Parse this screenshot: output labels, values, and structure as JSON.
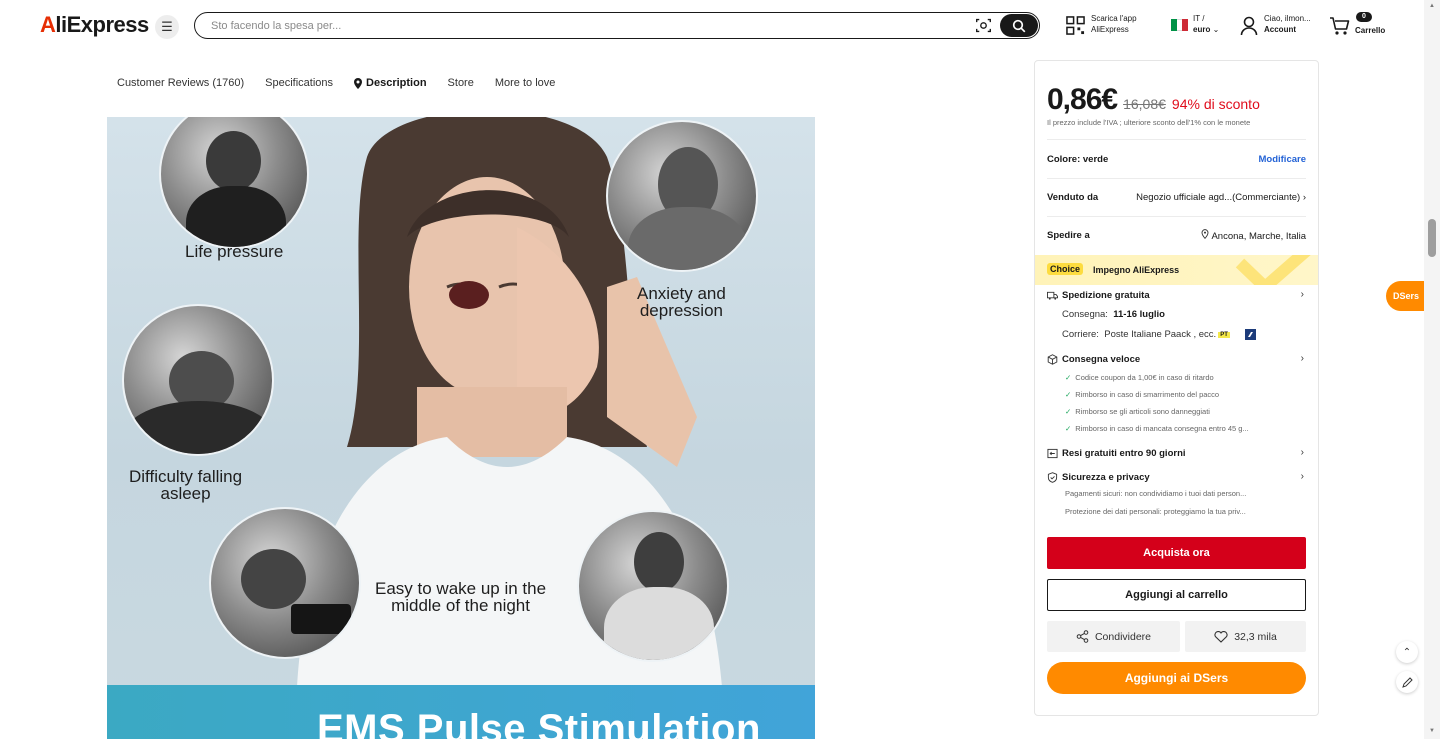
{
  "header": {
    "logo_text": "AliExpress",
    "search_placeholder": "Sto facendo la spesa per...",
    "app_line1": "Scarica l'app",
    "app_line2": "AliExpress",
    "lang_line1": "IT /",
    "lang_line2": "euro",
    "account_line1": "Ciao, ilmon...",
    "account_line2": "Account",
    "cart_count": "0",
    "cart_label": "Carrello"
  },
  "tabs": [
    {
      "label": "Customer Reviews (1760)"
    },
    {
      "label": "Specifications"
    },
    {
      "label": "Description"
    },
    {
      "label": "Store"
    },
    {
      "label": "More to love"
    }
  ],
  "product_image": {
    "captions": {
      "life_pressure": "Life pressure",
      "anxiety_1": "Anxiety and",
      "anxiety_2": "depression",
      "difficulty_1": "Difficulty falling",
      "difficulty_2": "asleep",
      "easy_1": "Easy to wake up in the",
      "easy_2": "middle of the night"
    },
    "banner_title": "EMS Pulse Stimulation"
  },
  "panel": {
    "price": "0,86€",
    "old_price": "16,08€",
    "discount": "94% di sconto",
    "vat_note": "Il prezzo include l'IVA ; ulteriore sconto dell'1% con le monete",
    "color_label": "Colore: verde",
    "color_edit": "Modificare",
    "seller_label": "Venduto da",
    "seller_value": "Negozio ufficiale agd...(Commerciante)",
    "ship_label": "Spedire a",
    "ship_value": "Ancona, Marche, Italia",
    "choice_badge": "Choice",
    "choice_text": "Impegno AliExpress",
    "free_shipping": "Spedizione gratuita",
    "delivery_label": "Consegna:",
    "delivery_value": "11-16 luglio",
    "carrier_label": "Corriere:",
    "carrier_value": "Poste Italiane Paack , ecc.",
    "carrier_badge": "PT",
    "fast_delivery": "Consegna veloce",
    "guarantees": [
      "Codice coupon da 1,00€ in caso di ritardo",
      "Rimborso in caso di smarrimento del pacco",
      "Rimborso se gli articoli sono danneggiati",
      "Rimborso in caso di mancata consegna entro 45 g..."
    ],
    "returns": "Resi gratuiti entro 90 giorni",
    "security": "Sicurezza e privacy",
    "security_notes": [
      "Pagamenti sicuri: non condividiamo i tuoi dati person...",
      "Protezione dei dati personali: proteggiamo la tua priv..."
    ],
    "buy_now": "Acquista ora",
    "add_to_cart": "Aggiungi al carrello",
    "share": "Condividere",
    "wishlist_count": "32,3 mila",
    "dsers_button": "Aggiungi ai DSers"
  },
  "side": {
    "dsers_tab": "DSers"
  },
  "colors": {
    "accent_red": "#d4001a",
    "discount_red": "#e00d1c",
    "dsers_orange": "#ff8a00",
    "link_blue": "#2463d6",
    "choice_yellow": "#fddc3f"
  }
}
